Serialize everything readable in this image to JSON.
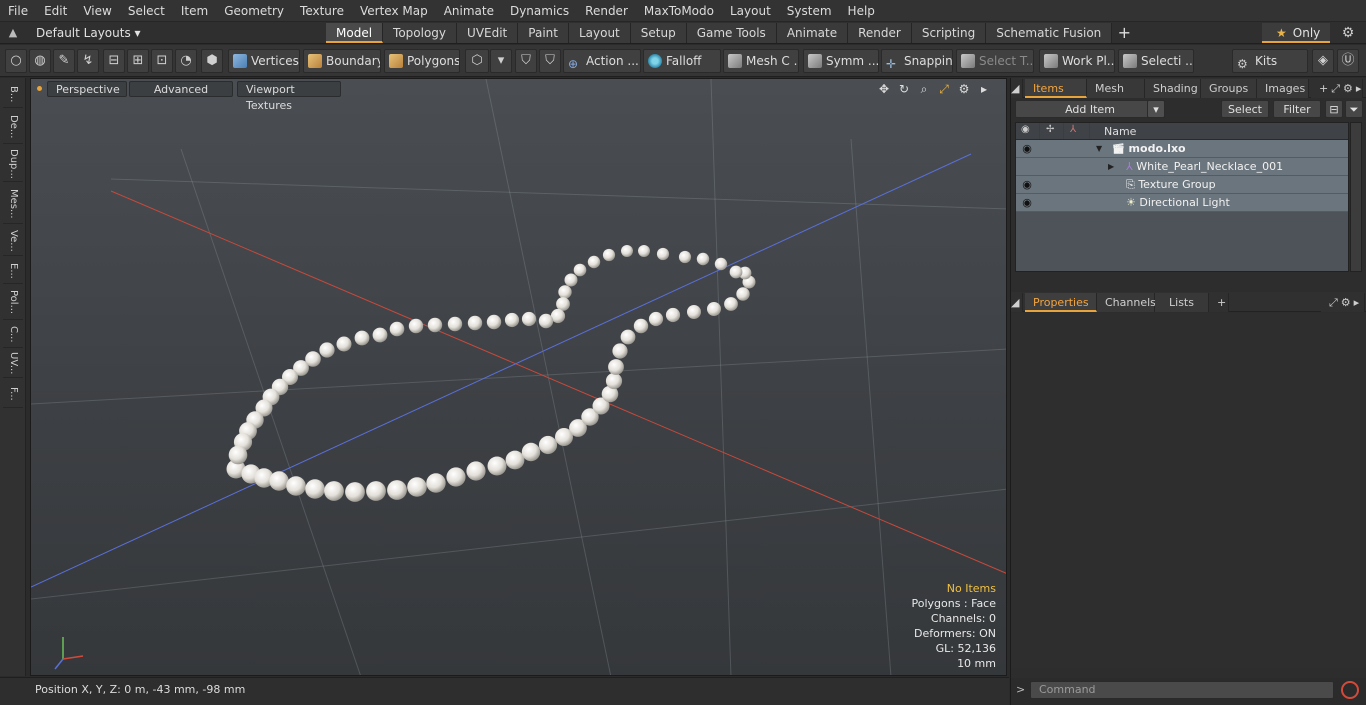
{
  "menu": [
    "File",
    "Edit",
    "View",
    "Select",
    "Item",
    "Geometry",
    "Texture",
    "Vertex Map",
    "Animate",
    "Dynamics",
    "Render",
    "MaxToModo",
    "Layout",
    "System",
    "Help"
  ],
  "layout": {
    "dropdown": "Default Layouts ▾",
    "tabs": [
      "Model",
      "Topology",
      "UVEdit",
      "Paint",
      "Layout",
      "Setup",
      "Game Tools",
      "Animate",
      "Render",
      "Scripting",
      "Schematic Fusion"
    ],
    "active_tab": "Model",
    "add_tab": "+",
    "only_label": "Only"
  },
  "toolbar": {
    "vertices": "Vertices",
    "boundary": "Boundary",
    "polygons": "Polygons",
    "action": "Action ...",
    "falloff": "Falloff",
    "mesh": "Mesh C ...",
    "symm": "Symm ...",
    "snapping": "Snapping",
    "select_t": "Select T...",
    "work_plane": "Work Pl...",
    "selecti": "Selecti ...",
    "kits": "Kits"
  },
  "left_strip": [
    "B...",
    "De...",
    "Dup...",
    "Mes...",
    "Ve...",
    "E...",
    "Pol...",
    "C...",
    "UV...",
    "F..."
  ],
  "viewport": {
    "perspective": "Perspective",
    "advanced": "Advanced",
    "textures": "Viewport Textures",
    "hud": {
      "title": "No Items",
      "polygons": "Polygons : Face",
      "channels": "Channels: 0",
      "deformers": "Deformers: ON",
      "gl": "GL: 52,136",
      "scale": "10 mm"
    }
  },
  "status": {
    "position": "Position X, Y, Z:   0 m, -43 mm, -98 mm"
  },
  "items_panel": {
    "tabs": [
      "Items",
      "Mesh ...",
      "Shading",
      "Groups",
      "Images"
    ],
    "active_tab": "Items",
    "add_item": "Add Item",
    "select": "Select",
    "filter": "Filter",
    "column_name": "Name",
    "rows": [
      {
        "label": "modo.lxo",
        "indent": 0
      },
      {
        "label": "White_Pearl_Necklace_001",
        "indent": 1
      },
      {
        "label": "Texture Group",
        "indent": 1
      },
      {
        "label": "Directional Light",
        "indent": 1
      }
    ]
  },
  "properties_panel": {
    "tabs": [
      "Properties",
      "Channels",
      "Lists"
    ],
    "active_tab": "Properties",
    "add_tab": "+"
  },
  "command": {
    "placeholder": "Command"
  },
  "colors": {
    "accent": "#e8a33a",
    "axis_x": "#c8493c",
    "axis_z": "#5a6fd8",
    "pearl": "#e4e0da"
  }
}
